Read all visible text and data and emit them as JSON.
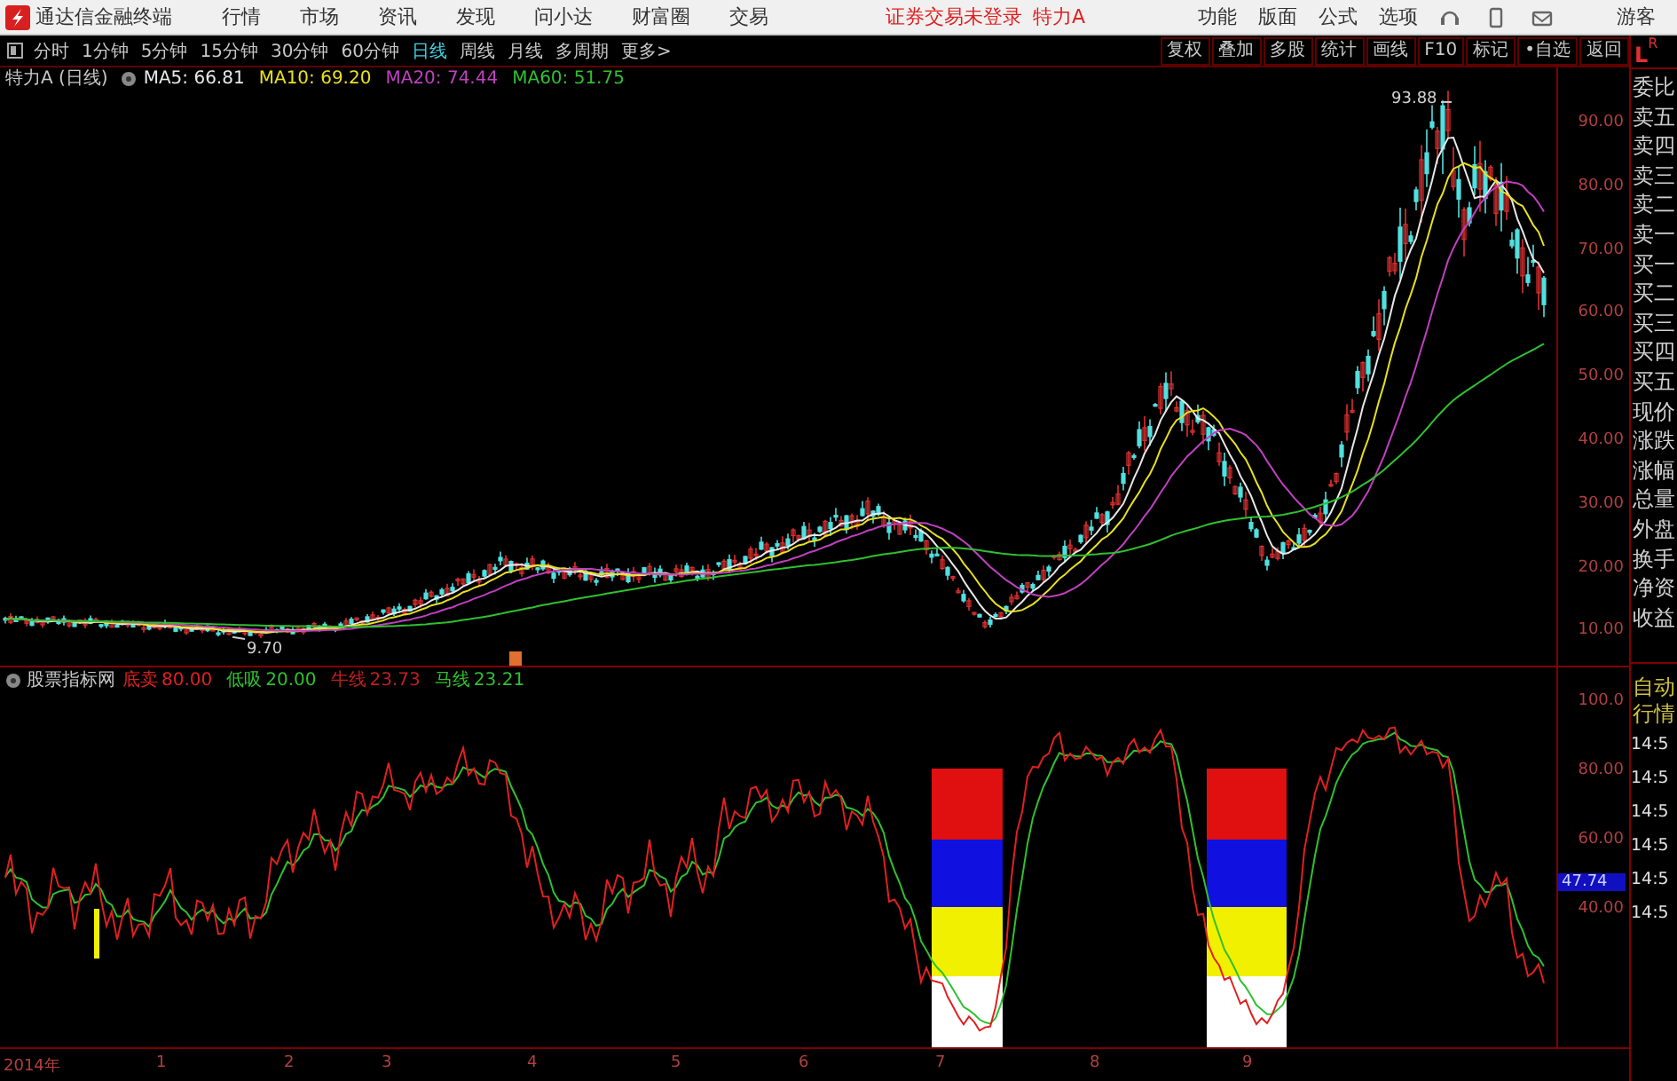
{
  "app": {
    "title": "通达信金融终端",
    "menu": [
      "行情",
      "市场",
      "资讯",
      "发现",
      "问小达",
      "财富圈",
      "交易"
    ],
    "login_status": "证券交易未登录",
    "stock": "特力A",
    "tools": [
      "功能",
      "版面",
      "公式",
      "选项"
    ],
    "user": "游客"
  },
  "toolbar": {
    "periods": [
      {
        "label": "分时",
        "selected": false
      },
      {
        "label": "1分钟",
        "selected": false
      },
      {
        "label": "5分钟",
        "selected": false
      },
      {
        "label": "15分钟",
        "selected": false
      },
      {
        "label": "30分钟",
        "selected": false
      },
      {
        "label": "60分钟",
        "selected": false
      },
      {
        "label": "日线",
        "selected": true
      },
      {
        "label": "周线",
        "selected": false
      },
      {
        "label": "月线",
        "selected": false
      },
      {
        "label": "多周期",
        "selected": false
      },
      {
        "label": "更多>",
        "selected": false
      }
    ],
    "buttons": [
      "复权",
      "叠加",
      "多股",
      "统计",
      "画线",
      "F10",
      "标记",
      "•自选",
      "返回"
    ],
    "corner": [
      "L",
      "R"
    ]
  },
  "main_chart": {
    "title": "特力A (日线)",
    "indicators": [
      {
        "label": "MA5: 66.81",
        "color": "#e8e8e8"
      },
      {
        "label": "MA10: 69.20",
        "color": "#e8e020"
      },
      {
        "label": "MA20: 74.44",
        "color": "#c040c0"
      },
      {
        "label": "MA60: 51.75",
        "color": "#30c030"
      }
    ],
    "axis": [
      "90.00",
      "80.00",
      "70.00",
      "60.00",
      "50.00",
      "40.00",
      "30.00",
      "20.00",
      "10.00"
    ],
    "high_label": "93.88",
    "low_label": "9.70"
  },
  "indicator_chart": {
    "title": "股票指标网",
    "params": [
      {
        "label": "底卖",
        "value": "80.00",
        "color": "#e02020"
      },
      {
        "label": "低吸",
        "value": "20.00",
        "color": "#30c030"
      },
      {
        "label": "牛线",
        "value": "23.73",
        "color": "#c02020"
      },
      {
        "label": "马线",
        "value": "23.21",
        "color": "#30c030"
      }
    ],
    "axis": [
      "100.0",
      "80.00",
      "60.00",
      "40.00"
    ],
    "current": "47.74"
  },
  "x_axis": [
    "2014年",
    "1",
    "2",
    "3",
    "4",
    "5",
    "6",
    "7",
    "8",
    "9"
  ],
  "side_panel": {
    "quote_labels": [
      "委比",
      "卖五",
      "卖四",
      "卖三",
      "卖二",
      "卖一",
      "买一",
      "买二",
      "买三",
      "买四",
      "买五",
      "现价",
      "涨跌",
      "涨幅",
      "总量",
      "外盘",
      "换手",
      "净资",
      "收益"
    ],
    "tabs": [
      "自动",
      "行情"
    ],
    "times": [
      "14:5",
      "14:5",
      "14:5",
      "14:5",
      "14:5",
      "14:5"
    ]
  }
}
